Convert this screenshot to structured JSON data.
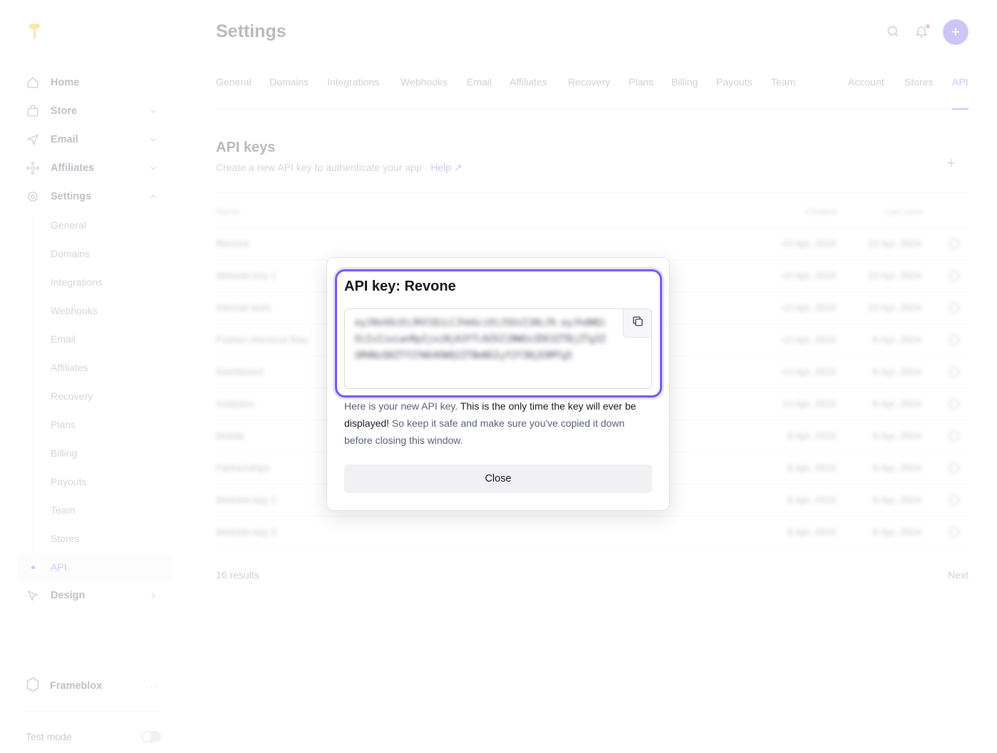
{
  "page": {
    "title": "Settings"
  },
  "sidebar": {
    "items": [
      {
        "label": "Home",
        "icon": "home-icon"
      },
      {
        "label": "Store",
        "icon": "bag-icon"
      },
      {
        "label": "Email",
        "icon": "send-icon"
      },
      {
        "label": "Affiliates",
        "icon": "network-icon"
      },
      {
        "label": "Settings",
        "icon": "gear-icon"
      }
    ],
    "sub_items": [
      "General",
      "Domains",
      "Integrations",
      "Webhooks",
      "Email",
      "Affiliates",
      "Recovery",
      "Plans",
      "Billing",
      "Payouts",
      "Team",
      "Stores",
      "API"
    ],
    "design": {
      "label": "Design",
      "icon": "cursor-icon"
    },
    "workspace": {
      "name": "Frameblox",
      "more": "···"
    },
    "test_mode": {
      "label": "Test mode",
      "enabled": false
    }
  },
  "tabs": [
    "General",
    "Domains",
    "Integrations",
    "Webhooks",
    "Email",
    "Affiliates",
    "Recovery",
    "Plans",
    "Billing",
    "Payouts",
    "Team",
    "Account",
    "Stores",
    "API"
  ],
  "active_tab": "API",
  "section": {
    "title": "API keys",
    "subtitle": "Create a new API key to authenticate your app ·",
    "help": "Help ↗",
    "add": "+"
  },
  "table": {
    "headers": {
      "name": "Name",
      "created": "Created",
      "last_used": "Last used"
    },
    "rows": [
      {
        "name": "Revone",
        "created": "10 Apr, 2024",
        "used": "10 Apr, 2024"
      },
      {
        "name": "Website key 1",
        "created": "10 Apr, 2024",
        "used": "10 Apr, 2024"
      },
      {
        "name": "Internal tools",
        "created": "10 Apr, 2024",
        "used": "10 Apr, 2024"
      },
      {
        "name": "Framer checkout flow",
        "created": "10 Apr, 2024",
        "used": "8 Apr, 2024"
      },
      {
        "name": "Dashboard",
        "created": "10 Apr, 2024",
        "used": "8 Apr, 2024"
      },
      {
        "name": "Analytics",
        "created": "10 Apr, 2024",
        "used": "8 Apr, 2024"
      },
      {
        "name": "Mobile",
        "created": "8 Apr, 2024",
        "used": "8 Apr, 2024"
      },
      {
        "name": "Partnerships",
        "created": "8 Apr, 2024",
        "used": "8 Apr, 2024"
      },
      {
        "name": "Website key 2",
        "created": "8 Apr, 2024",
        "used": "8 Apr, 2024"
      },
      {
        "name": "Website key 3",
        "created": "8 Apr, 2024",
        "used": "8 Apr, 2024"
      }
    ],
    "results": "16 results",
    "next": "Next"
  },
  "modal": {
    "title": "API key: Revone",
    "key": "eyJ0eXAiOiJKV1QiLCJhbGciOiJSUzI1NiJ9.eyJhdWQiOiIxIiwianRpIjoiNjA3YTc0ZGI1NWUzZDE3ZTBjZTg3ZGM4NzQ0ZTY2YWU4OWQ2ZTBmNGIyY2Y3NjE0MTg5",
    "desc_plain_1": "Here is your new API key. ",
    "desc_strong": "This is the only time the key will ever be displayed!",
    "desc_plain_2": " So keep it safe and make sure you've copied it down before closing this window.",
    "close_label": "Close"
  },
  "colors": {
    "accent": "#6a4ee6",
    "focus": "#6e5df0",
    "danger": "#e5484d"
  }
}
